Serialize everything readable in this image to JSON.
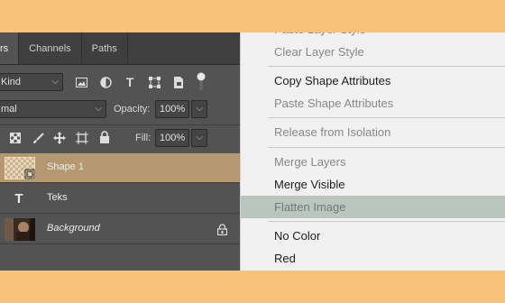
{
  "layers_panel": {
    "tabs": [
      {
        "label": "rs"
      },
      {
        "label": "Channels"
      },
      {
        "label": "Paths"
      }
    ],
    "filter": {
      "value": "Kind"
    },
    "blend_mode": {
      "value": "mal"
    },
    "opacity": {
      "label": "Opacity:",
      "value": "100%"
    },
    "fill": {
      "label": "Fill:",
      "value": "100%"
    },
    "layers": [
      {
        "name": "Shape 1",
        "selected": true
      },
      {
        "name": "Teks",
        "thumb": "T"
      },
      {
        "name": "Background",
        "locked": true
      }
    ],
    "colors": {
      "panel": "#535353",
      "selected_layer": "#b59870"
    }
  },
  "context_menu": {
    "items": [
      {
        "label": "Paste Layer Style",
        "enabled": false
      },
      {
        "label": "Clear Layer Style",
        "enabled": false
      },
      {
        "label": "Copy Shape Attributes",
        "enabled": true
      },
      {
        "label": "Paste Shape Attributes",
        "enabled": false
      },
      {
        "label": "Release from Isolation",
        "enabled": false
      },
      {
        "label": "Merge Layers",
        "enabled": false
      },
      {
        "label": "Merge Visible",
        "enabled": true
      },
      {
        "label": "Flatten Image",
        "enabled": false,
        "highlighted": true
      },
      {
        "label": "No Color",
        "enabled": true
      },
      {
        "label": "Red",
        "enabled": true
      }
    ],
    "highlight_color": "#b9c6c0"
  },
  "background_color": "#f8c27b"
}
